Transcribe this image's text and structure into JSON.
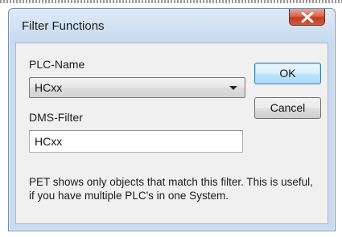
{
  "window": {
    "title": "Filter Functions"
  },
  "icons": {
    "close": "close-icon",
    "dropdown": "chevron-down-icon"
  },
  "colors": {
    "close_button": "#c94a30",
    "dialog_frame": "#c9dbef",
    "client_bg": "#f0f0f0",
    "default_button": "#bee6fd"
  },
  "form": {
    "plc_name_label": "PLC-Name",
    "plc_name_value": "HCxx",
    "dms_filter_label": "DMS-Filter",
    "dms_filter_value": "HCxx"
  },
  "buttons": {
    "ok_label": "OK",
    "cancel_label": "Cancel"
  },
  "info": {
    "text": "PET shows only objects that match this filter. This is useful, if you have multiple PLC's in one System."
  }
}
